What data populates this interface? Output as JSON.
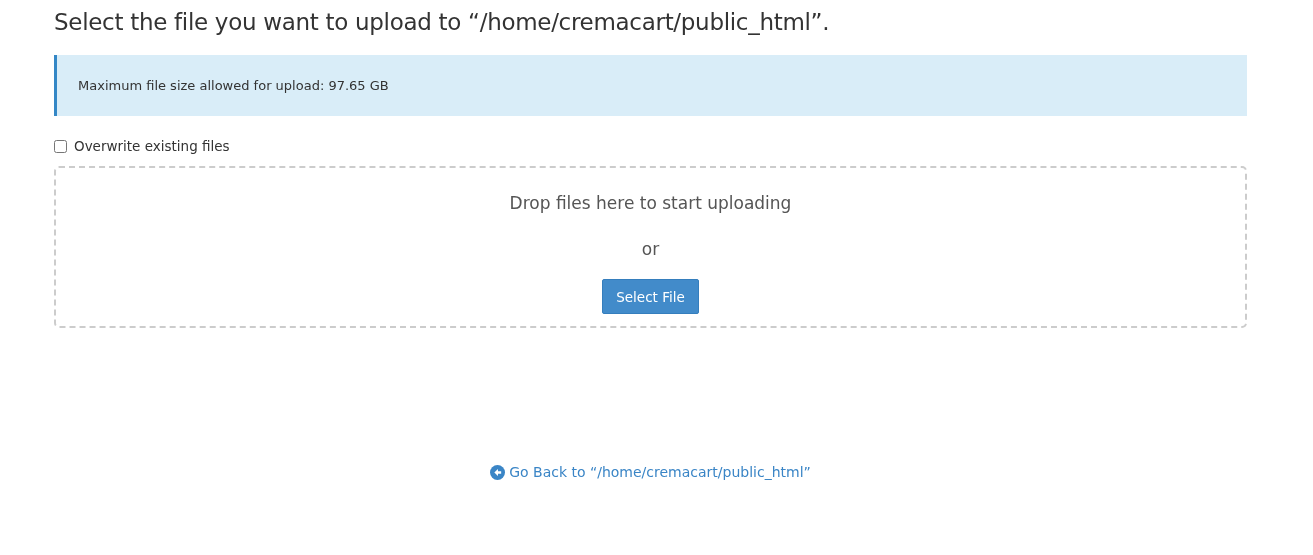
{
  "title": "Select the file you want to upload to “/home/cremacart/public_html”.",
  "alert": {
    "text": "Maximum file size allowed for upload: 97.65 GB"
  },
  "overwrite": {
    "label": "Overwrite existing files",
    "checked": false
  },
  "dropzone": {
    "prompt": "Drop files here to start uploading",
    "separator": "or",
    "button": "Select File"
  },
  "back_link": {
    "label": "Go Back to “/home/cremacart/public_html”"
  }
}
